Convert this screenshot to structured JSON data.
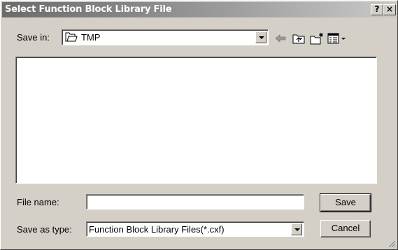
{
  "window": {
    "title": "Select Function Block Library File",
    "help_label": "?",
    "close_label": "×"
  },
  "save_in": {
    "label": "Save in:",
    "value": "TMP",
    "icon": "folder-icon"
  },
  "toolbar": {
    "icons": [
      "back-arrow-icon",
      "up-folder-icon",
      "new-folder-icon",
      "view-menu-icon"
    ]
  },
  "file_name": {
    "label": "File name:",
    "value": ""
  },
  "save_as_type": {
    "label": "Save as type:",
    "value": "Function Block Library Files(*.cxf)"
  },
  "buttons": {
    "save": "Save",
    "cancel": "Cancel"
  }
}
